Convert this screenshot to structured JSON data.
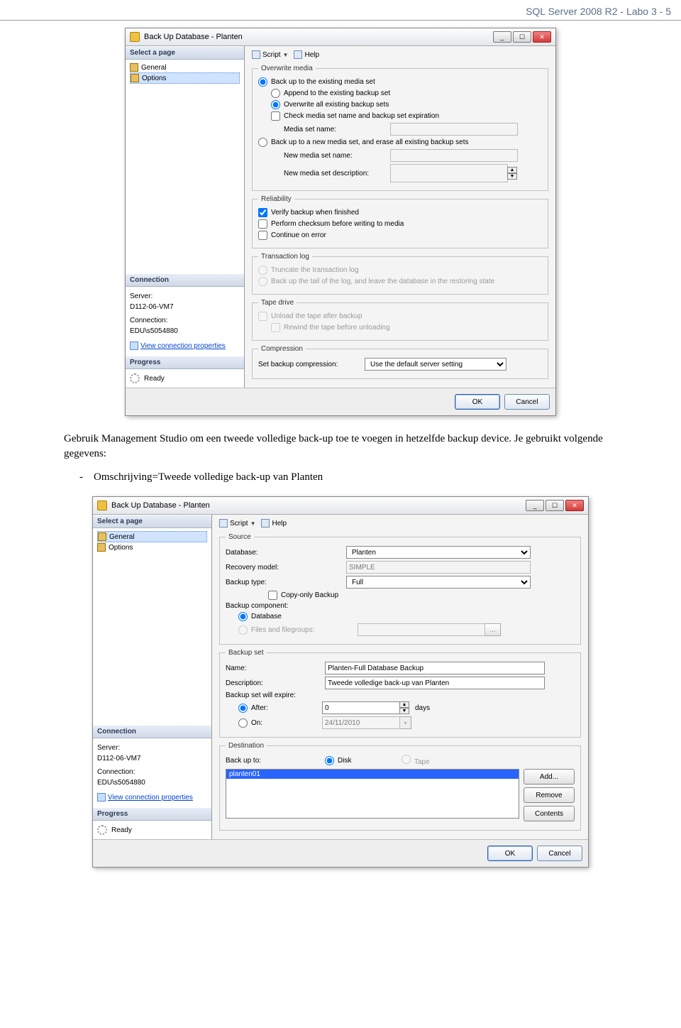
{
  "pageHeader": "SQL Server 2008 R2 - Labo 3 - 5",
  "docText": "Gebruik Management Studio om een tweede volledige back-up toe te voegen in hetzelfde backup device. Je gebruikt volgende gegevens:",
  "docBullet": "-    Omschrijving=Tweede volledige back-up van Planten",
  "dlgTitle": "Back Up Database - Planten",
  "sidebar": {
    "selectPage": "Select a page",
    "general": "General",
    "options": "Options",
    "connection": "Connection",
    "serverLbl": "Server:",
    "serverVal": "D112-06-VM7",
    "connLbl": "Connection:",
    "connVal": "EDU\\s5054880",
    "viewProps": "View connection properties",
    "progress": "Progress",
    "ready": "Ready"
  },
  "toolbar": {
    "script": "Script",
    "help": "Help"
  },
  "d1": {
    "overwriteMedia": "Overwrite media",
    "backupExisting": "Back up to the existing media set",
    "appendExisting": "Append to the existing backup set",
    "overwriteAll": "Overwrite all existing backup sets",
    "checkMedia": "Check media set name and backup set expiration",
    "mediaSetName": "Media set name:",
    "backupNewErase": "Back up to a new media set, and erase all existing backup sets",
    "newMediaName": "New media set name:",
    "newMediaDesc": "New media set description:",
    "reliability": "Reliability",
    "verify": "Verify backup when finished",
    "checksum": "Perform checksum before writing to media",
    "contErr": "Continue on error",
    "tlog": "Transaction log",
    "truncate": "Truncate the transaction log",
    "backupTail": "Back up the tail of the log, and leave the database in the restoring state",
    "tape": "Tape drive",
    "unload": "Unload the tape after backup",
    "rewind": "Rewind the tape before unloading",
    "compression": "Compression",
    "setComp": "Set backup compression:",
    "compVal": "Use the default server setting"
  },
  "d2": {
    "source": "Source",
    "database": "Database:",
    "dbVal": "Planten",
    "recovery": "Recovery model:",
    "recoveryVal": "SIMPLE",
    "backupType": "Backup type:",
    "backupTypeVal": "Full",
    "copyOnly": "Copy-only Backup",
    "component": "Backup component:",
    "compDb": "Database",
    "compFg": "Files and filegroups:",
    "backupSet": "Backup set",
    "name": "Name:",
    "nameVal": "Planten-Full Database Backup",
    "desc": "Description:",
    "descVal": "Tweede volledige back-up van Planten",
    "expire": "Backup set will expire:",
    "after": "After:",
    "afterVal": "0",
    "days": "days",
    "on": "On:",
    "onVal": "24/11/2010",
    "dest": "Destination",
    "backupTo": "Back up to:",
    "disk": "Disk",
    "tape": "Tape",
    "listItem": "planten01",
    "add": "Add...",
    "remove": "Remove",
    "contents": "Contents"
  },
  "btns": {
    "ok": "OK",
    "cancel": "Cancel"
  }
}
